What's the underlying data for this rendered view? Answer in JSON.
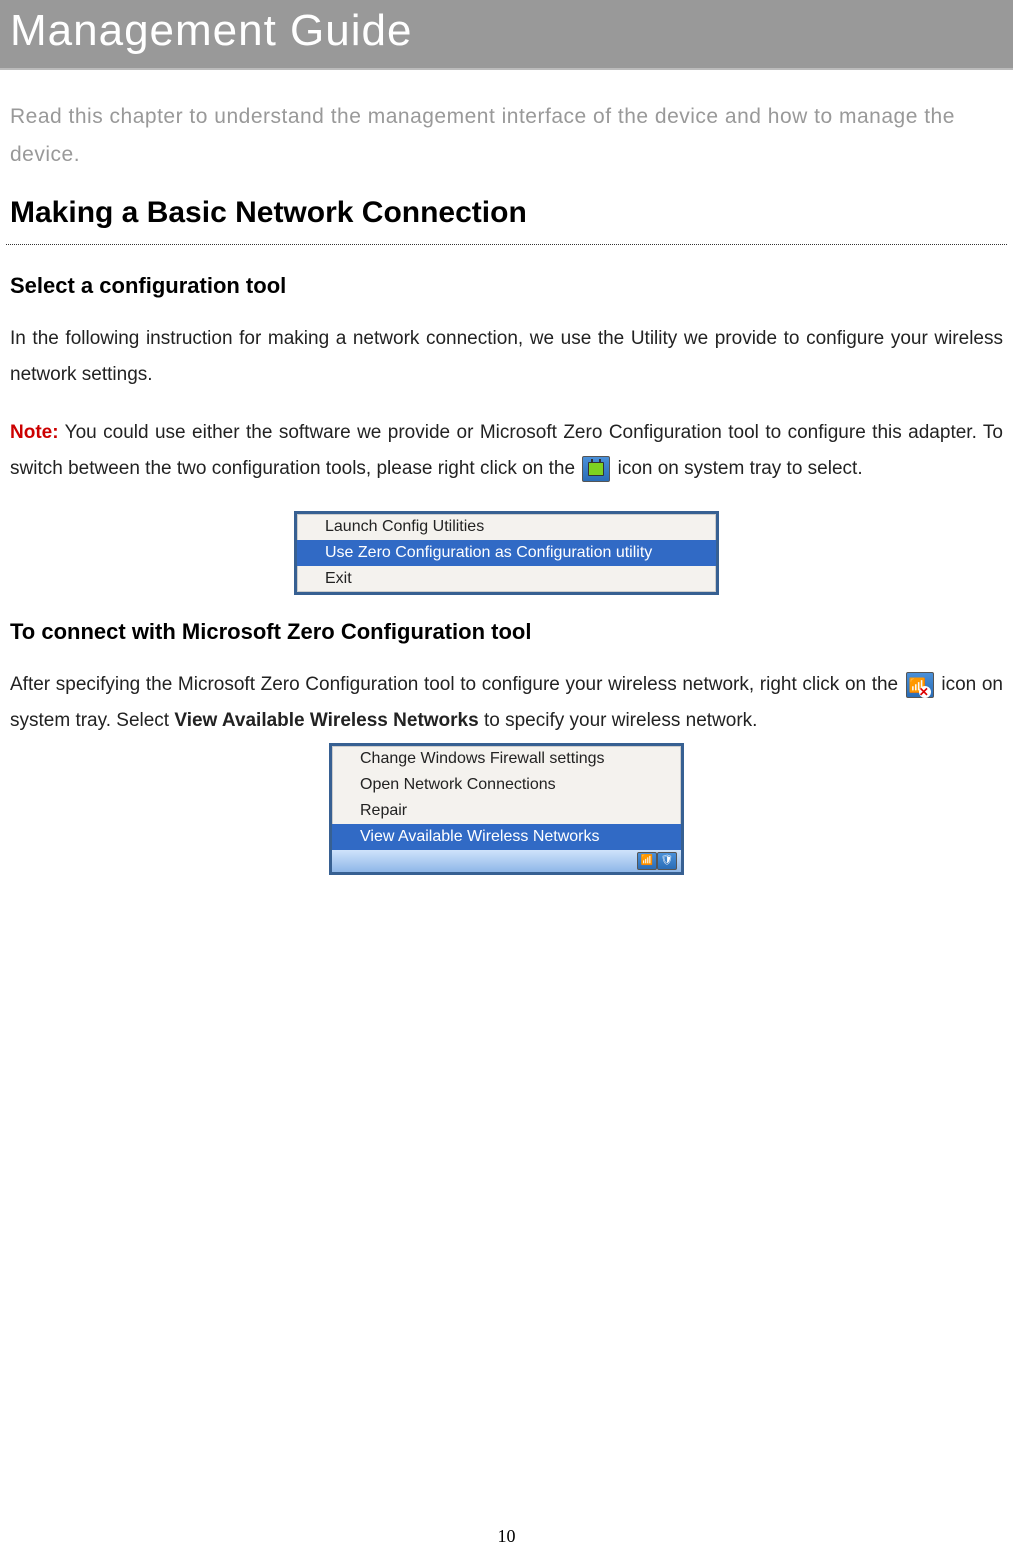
{
  "title": "Management Guide",
  "intro": "Read this chapter to understand the management interface of the device and how to manage the device.",
  "h2": "Making a Basic Network Connection",
  "section1": {
    "heading": "Select a configuration tool",
    "para1": "In the following instruction for making a network connection, we use the Utility we provide to configure your wireless network settings.",
    "note_label": "Note:",
    "note_before": " You could use either the software we provide or Microsoft Zero Configuration tool to configure this adapter. To switch between the two configuration tools, please right click on the ",
    "note_after": " icon on system tray to select."
  },
  "menu1": {
    "items": [
      "Launch Config Utilities",
      "Use Zero Configuration as Configuration utility",
      "Exit"
    ]
  },
  "section2": {
    "heading": "To connect with Microsoft Zero Configuration tool",
    "para_before": "After specifying the Microsoft Zero Configuration tool to configure your wireless network, right click on the ",
    "para_mid": " icon on system tray. Select ",
    "bold": "View Available Wireless Networks",
    "para_after": " to specify your wireless network."
  },
  "menu2": {
    "items": [
      "Change Windows Firewall settings",
      "Open Network Connections",
      "Repair",
      "View Available Wireless Networks"
    ]
  },
  "page_number": "10"
}
